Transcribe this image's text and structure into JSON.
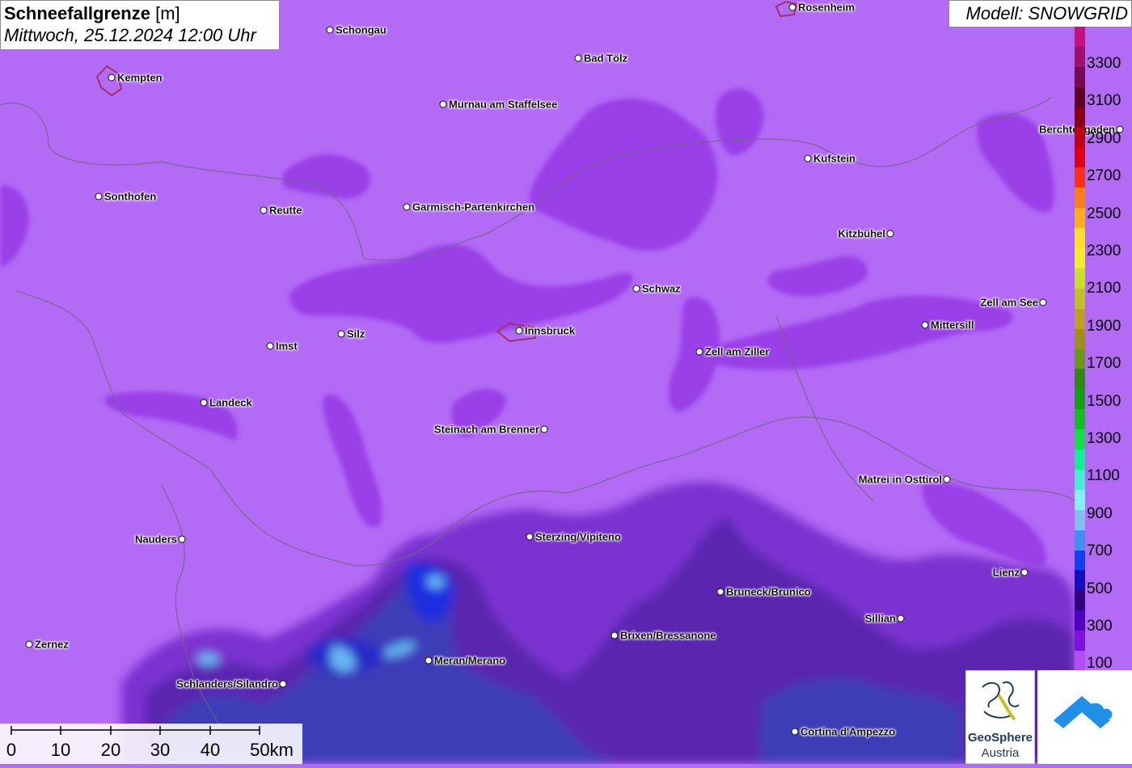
{
  "header": {
    "title_bold": "Schneefallgrenze",
    "title_unit": "[m]",
    "subtitle": "Mittwoch, 25.12.2024 12:00 Uhr",
    "model_label": "Modell: SNOWGRID"
  },
  "cities": [
    {
      "name": "Rosenheim",
      "label_side": "right"
    },
    {
      "name": "Schongau",
      "label_side": "right"
    },
    {
      "name": "Kempten",
      "label_side": "right"
    },
    {
      "name": "Bad Tölz",
      "label_side": "right"
    },
    {
      "name": "Murnau am Staffelsee",
      "label_side": "right"
    },
    {
      "name": "Berchtesgaden",
      "label_side": "left"
    },
    {
      "name": "Kufstein",
      "label_side": "right"
    },
    {
      "name": "Sonthofen",
      "label_side": "right"
    },
    {
      "name": "Reutte",
      "label_side": "right"
    },
    {
      "name": "Garmisch-Partenkirchen",
      "label_side": "right"
    },
    {
      "name": "Kitzbühel",
      "label_side": "left"
    },
    {
      "name": "Schwaz",
      "label_side": "right"
    },
    {
      "name": "Zell am See",
      "label_side": "left"
    },
    {
      "name": "Mittersill",
      "label_side": "right"
    },
    {
      "name": "Silz",
      "label_side": "right"
    },
    {
      "name": "Innsbruck",
      "label_side": "right"
    },
    {
      "name": "Imst",
      "label_side": "right"
    },
    {
      "name": "Zell am Ziller",
      "label_side": "right"
    },
    {
      "name": "Landeck",
      "label_side": "right"
    },
    {
      "name": "Steinach am Brenner",
      "label_side": "left"
    },
    {
      "name": "Matrei in Osttirol",
      "label_side": "left"
    },
    {
      "name": "Nauders",
      "label_side": "left"
    },
    {
      "name": "Sterzing/Vipiteno",
      "label_side": "right"
    },
    {
      "name": "Lienz",
      "label_side": "left"
    },
    {
      "name": "Bruneck/Brunico",
      "label_side": "right"
    },
    {
      "name": "Sillian",
      "label_side": "left"
    },
    {
      "name": "Brixen/Bressanone",
      "label_side": "right"
    },
    {
      "name": "Zernez",
      "label_side": "right"
    },
    {
      "name": "Meran/Merano",
      "label_side": "right"
    },
    {
      "name": "Schlanders/Silandro",
      "label_side": "left"
    },
    {
      "name": "Cortina d'Ampezzo",
      "label_side": "right"
    }
  ],
  "legend": {
    "ticks": [
      "3300",
      "3100",
      "2900",
      "2700",
      "2500",
      "2300",
      "2100",
      "1900",
      "1700",
      "1500",
      "1300",
      "1100",
      "900",
      "700",
      "500",
      "300",
      "100"
    ],
    "colors": [
      "#c8107a",
      "#a0106a",
      "#7a0a50",
      "#600020",
      "#8a0010",
      "#c00010",
      "#e00010",
      "#ff3010",
      "#ff8010",
      "#ffb010",
      "#ffe020",
      "#f0f020",
      "#c8e020",
      "#c0c020",
      "#c0a020",
      "#a09010",
      "#6a9a10",
      "#308a10",
      "#10a010",
      "#10c020",
      "#10e040",
      "#10f090",
      "#40f0d0",
      "#80f0f0",
      "#80c0f0",
      "#4090f0",
      "#1040f0",
      "#1010c0",
      "#300080",
      "#5000c0",
      "#8010e0",
      "#b050f0"
    ]
  },
  "scale": {
    "ticks": [
      "0",
      "10",
      "20",
      "30",
      "40",
      "50km"
    ]
  },
  "logos": {
    "geosphere_line1": "GeoSphere",
    "geosphere_line2": "Austria"
  }
}
